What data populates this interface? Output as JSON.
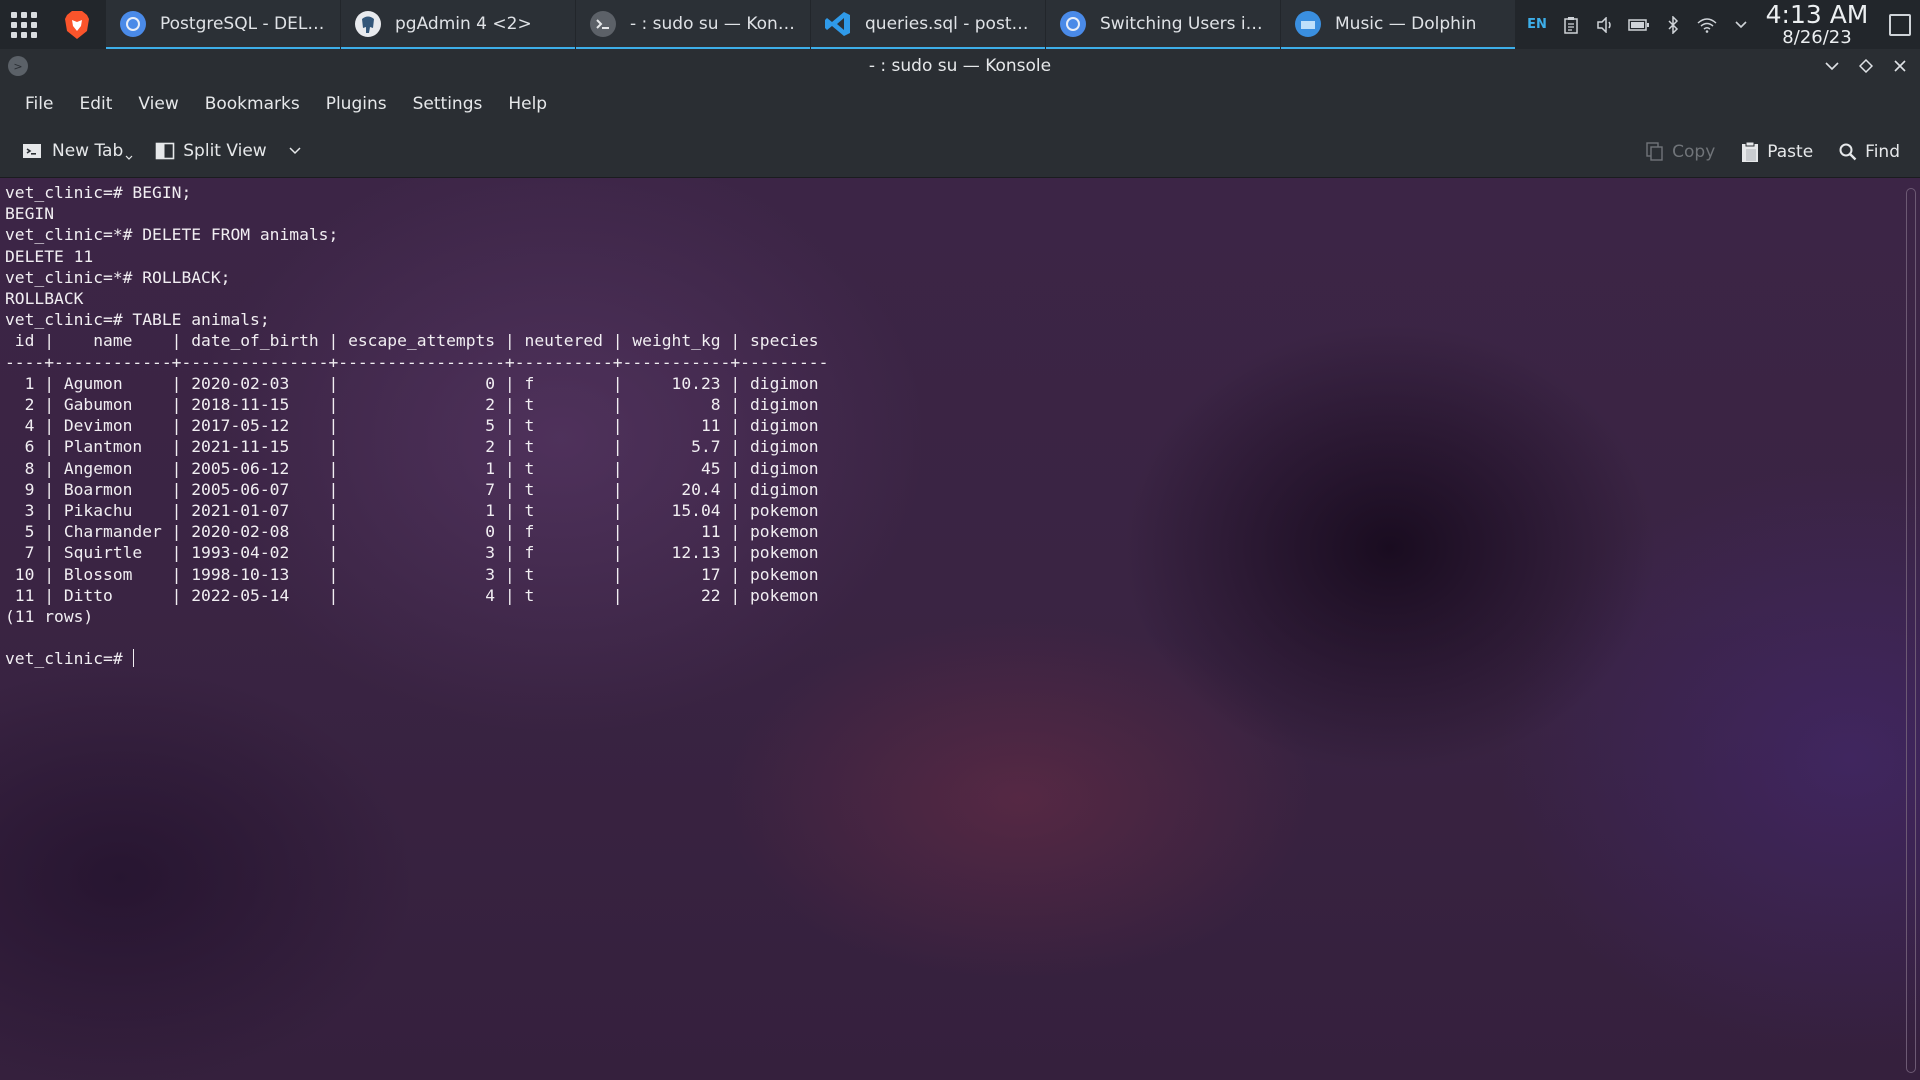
{
  "taskbar": {
    "tasks": [
      {
        "label": "PostgreSQL - DELET...",
        "icon": "chromium-icon"
      },
      {
        "label": "pgAdmin 4 <2>",
        "icon": "pgadmin-elephant-icon"
      },
      {
        "label": "- : sudo su — Konsole",
        "icon": "konsole-icon"
      },
      {
        "label": "queries.sql - postgre...",
        "icon": "vscode-icon"
      },
      {
        "label": "Switching Users in P...",
        "icon": "chromium-icon"
      },
      {
        "label": "Music — Dolphin",
        "icon": "dolphin-folder-icon"
      }
    ],
    "tray": {
      "lang": "EN",
      "time": "4:13 AM",
      "date": "8/26/23"
    },
    "colors": {
      "accent": "#3daee9",
      "panel": "#22262b"
    }
  },
  "window": {
    "title": "- : sudo su — Konsole"
  },
  "menubar": {
    "items": [
      "File",
      "Edit",
      "View",
      "Bookmarks",
      "Plugins",
      "Settings",
      "Help"
    ]
  },
  "toolbar": {
    "new_tab": "New Tab",
    "split_view": "Split View",
    "copy": "Copy",
    "paste": "Paste",
    "find": "Find"
  },
  "terminal": {
    "lines": [
      "vet_clinic=# BEGIN;",
      "BEGIN",
      "vet_clinic=*# DELETE FROM animals;",
      "DELETE 11",
      "vet_clinic=*# ROLLBACK;",
      "ROLLBACK",
      "vet_clinic=# TABLE animals;",
      " id |    name    | date_of_birth | escape_attempts | neutered | weight_kg | species",
      "----+------------+---------------+-----------------+----------+-----------+---------",
      "  1 | Agumon     | 2020-02-03    |               0 | f        |     10.23 | digimon",
      "  2 | Gabumon    | 2018-11-15    |               2 | t        |         8 | digimon",
      "  4 | Devimon    | 2017-05-12    |               5 | t        |        11 | digimon",
      "  6 | Plantmon   | 2021-11-15    |               2 | t        |       5.7 | digimon",
      "  8 | Angemon    | 2005-06-12    |               1 | t        |        45 | digimon",
      "  9 | Boarmon    | 2005-06-07    |               7 | t        |      20.4 | digimon",
      "  3 | Pikachu    | 2021-01-07    |               1 | t        |     15.04 | pokemon",
      "  5 | Charmander | 2020-02-08    |               0 | f        |        11 | pokemon",
      "  7 | Squirtle   | 1993-04-02    |               3 | f        |     12.13 | pokemon",
      " 10 | Blossom    | 1998-10-13    |               3 | t        |        17 | pokemon",
      " 11 | Ditto      | 2022-05-14    |               4 | t        |        22 | pokemon",
      "(11 rows)",
      ""
    ],
    "prompt": "vet_clinic=# "
  }
}
